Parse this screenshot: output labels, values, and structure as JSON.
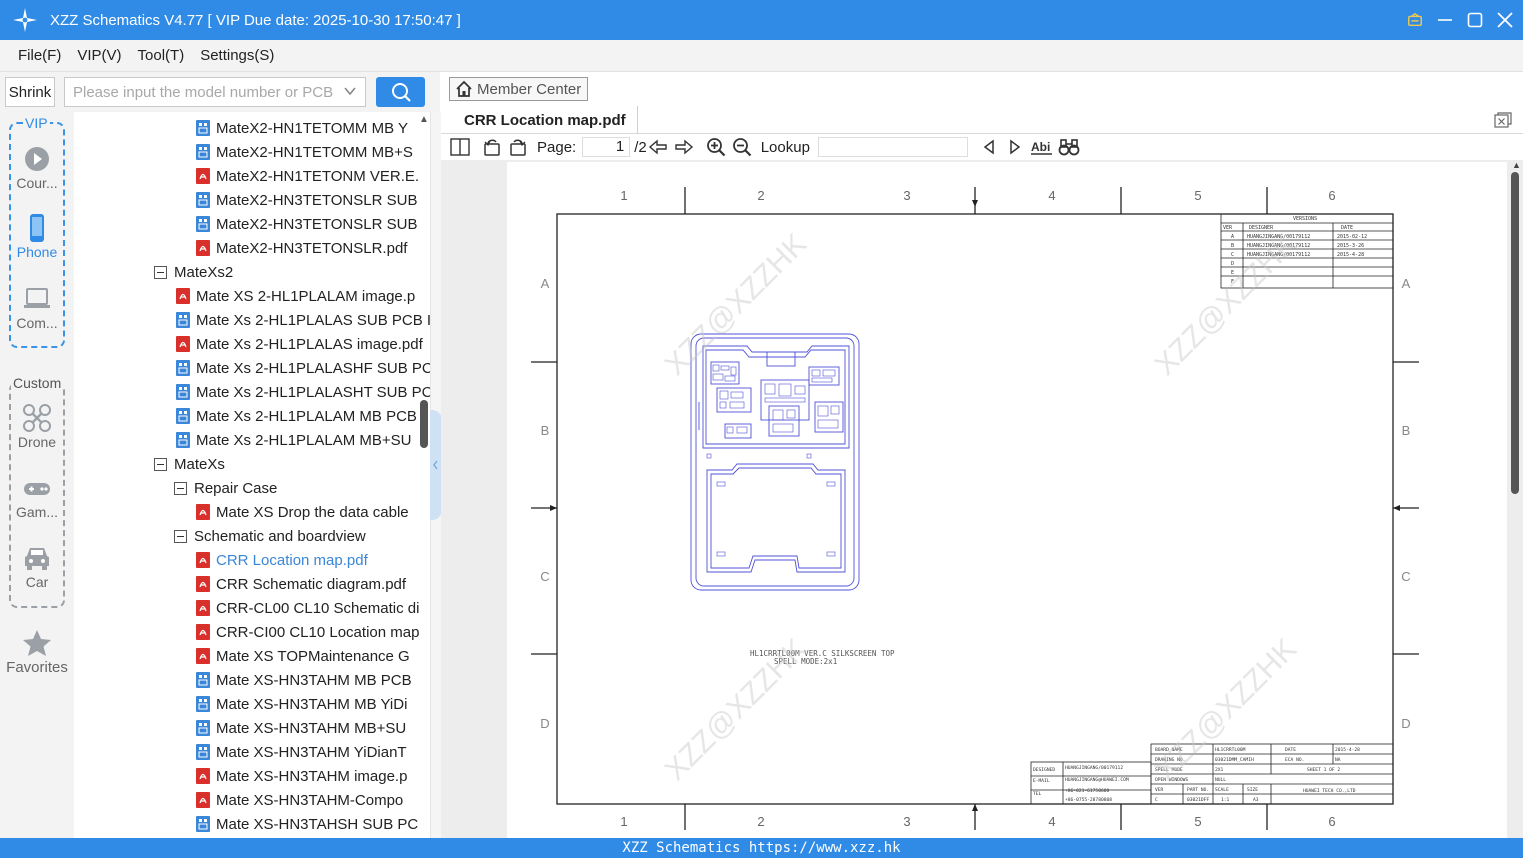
{
  "window": {
    "title": "XZZ Schematics V4.77 [ VIP Due date: 2025-10-30 17:50:47 ]",
    "controls": [
      "vip-crown-icon",
      "minimize-icon",
      "maximize-icon",
      "close-icon"
    ]
  },
  "menu": [
    "File(F)",
    "VIP(V)",
    "Tool(T)",
    "Settings(S)"
  ],
  "search": {
    "shrink_label": "Shrink",
    "placeholder": "Please input the model number or PCB"
  },
  "rail": {
    "vip_label": "VIP",
    "custom_label": "Custom",
    "vip_items": [
      {
        "label": "Cour...",
        "icon": "play-icon",
        "active": false
      },
      {
        "label": "Phone",
        "icon": "phone-icon",
        "active": true
      },
      {
        "label": "Com...",
        "icon": "laptop-icon",
        "active": false
      }
    ],
    "custom_items": [
      {
        "label": "Drone",
        "icon": "drone-icon"
      },
      {
        "label": "Gam...",
        "icon": "gamepad-icon"
      },
      {
        "label": "Car",
        "icon": "car-icon"
      }
    ],
    "favorites_label": "Favorites"
  },
  "tree": [
    {
      "type": "pcb",
      "label": "MateX2-HN1TETOMM MB Y",
      "indent": 2
    },
    {
      "type": "pcb",
      "label": "MateX2-HN1TETOMM MB+S",
      "indent": 2
    },
    {
      "type": "pdf",
      "label": "MateX2-HN1TETONM VER.E.",
      "indent": 2
    },
    {
      "type": "pcb",
      "label": "MateX2-HN3TETONSLR SUB",
      "indent": 2
    },
    {
      "type": "pcb",
      "label": "MateX2-HN3TETONSLR SUB",
      "indent": 2
    },
    {
      "type": "pdf",
      "label": "MateX2-HN3TETONSLR.pdf",
      "indent": 2
    },
    {
      "type": "folder",
      "label": "MateXs2",
      "indent": 0
    },
    {
      "type": "pdf",
      "label": "Mate XS 2-HL1PLALAM image.p",
      "indent": 1
    },
    {
      "type": "pcb",
      "label": "Mate Xs 2-HL1PLALAS SUB PCB I",
      "indent": 1
    },
    {
      "type": "pdf",
      "label": "Mate Xs 2-HL1PLALAS image.pdf",
      "indent": 1
    },
    {
      "type": "pcb",
      "label": "Mate Xs 2-HL1PLALASHF SUB PC",
      "indent": 1
    },
    {
      "type": "pcb",
      "label": "Mate Xs 2-HL1PLALASHT SUB PC",
      "indent": 1
    },
    {
      "type": "pcb",
      "label": "Mate Xs 2-HL1PLALAM MB PCB",
      "indent": 1
    },
    {
      "type": "pcb",
      "label": "Mate Xs 2-HL1PLALAM MB+SU",
      "indent": 1
    },
    {
      "type": "folder",
      "label": "MateXs",
      "indent": 0
    },
    {
      "type": "folder",
      "label": "Repair Case",
      "indent": 1
    },
    {
      "type": "pdf",
      "label": "Mate XS Drop the data cable",
      "indent": 2
    },
    {
      "type": "folder",
      "label": "Schematic and boardview",
      "indent": 1
    },
    {
      "type": "pdf",
      "label": "CRR Location map.pdf",
      "indent": 2,
      "selected": true
    },
    {
      "type": "pdf",
      "label": "CRR Schematic diagram.pdf",
      "indent": 2
    },
    {
      "type": "pdf",
      "label": "CRR-CL00 CL10 Schematic di",
      "indent": 2
    },
    {
      "type": "pdf",
      "label": "CRR-CI00 CL10 Location map",
      "indent": 2
    },
    {
      "type": "pdf",
      "label": "Mate XS TOPMaintenance G",
      "indent": 2
    },
    {
      "type": "pcb",
      "label": "Mate XS-HN3TAHM MB PCB",
      "indent": 2
    },
    {
      "type": "pcb",
      "label": "Mate XS-HN3TAHM MB YiDi",
      "indent": 2
    },
    {
      "type": "pcb",
      "label": "Mate XS-HN3TAHM MB+SU",
      "indent": 2
    },
    {
      "type": "pcb",
      "label": "Mate XS-HN3TAHM YiDianT",
      "indent": 2
    },
    {
      "type": "pdf",
      "label": "Mate XS-HN3TAHM image.p",
      "indent": 2
    },
    {
      "type": "pdf",
      "label": "Mate XS-HN3TAHM-Compo",
      "indent": 2
    },
    {
      "type": "pcb",
      "label": "Mate XS-HN3TAHSH SUB PC",
      "indent": 2
    }
  ],
  "viewer": {
    "member_center": "Member Center",
    "tab_title": "CRR Location map.pdf",
    "page_label": "Page:",
    "page_current": "1",
    "page_total": "/2",
    "lookup_label": "Lookup",
    "lookup_value": ""
  },
  "drawing": {
    "col_labels": [
      "1",
      "2",
      "3",
      "4",
      "5",
      "6"
    ],
    "row_labels": [
      "A",
      "B",
      "C",
      "D"
    ],
    "watermark": "XZZ@XZZHK",
    "silkscreen_line1": "HL1CRRTL00M VER.C SILKSCREEN TOP",
    "silkscreen_line2": "SPELL MODE:2x1",
    "versions_title": "VERSIONS",
    "versions_headers": [
      "VER",
      "DESIGNER",
      "DATE"
    ],
    "versions_rows": [
      [
        "A",
        "HUANGJINGANG/00179112",
        "2015-02-12"
      ],
      [
        "B",
        "HUANGJINGANG/00179112",
        "2015-3-26"
      ],
      [
        "C",
        "HUANGJINGANG/00179112",
        "2015-4-28"
      ],
      [
        "D",
        "",
        ""
      ],
      [
        "E",
        "",
        ""
      ],
      [
        "F",
        "",
        ""
      ]
    ],
    "titleblock": {
      "board_name_label": "BOARD NAME",
      "board_name": "HL1CRRTL00M",
      "date_label": "DATE",
      "date": "2015-4-28",
      "drawing_no_label": "DRAWING NO.",
      "drawing_no": "03021DMM_CAMIH",
      "eca_label": "ECA NO.",
      "eca": "NA",
      "spell_label": "SPELL MODE",
      "spell": "2X1",
      "sheet": "SHEET 1 OF 2",
      "open_label": "OPEN WINDOWS",
      "open": "NULL",
      "ver_label": "VER",
      "ver": "C",
      "part_label": "PART NO.",
      "part": "03021DFF",
      "scale_label": "SCALE",
      "scale": "1:1",
      "size_label": "SIZE",
      "size": "A3",
      "company": "HUAWEI TECH CO.,LTD",
      "designed_label": "DESIGNED",
      "designed": "HUANGJINGANG/00179112",
      "email_label": "E-MAIL",
      "email": "HUANGJINGANG@HUAWEI.COM",
      "tel_label": "TEL",
      "tel1": "+86-021-61750600",
      "tel2": "+86-0755-28780808"
    }
  },
  "status": "XZZ Schematics https://www.xzz.hk",
  "colors": {
    "accent": "#2f8be6",
    "pdf": "#d9302c",
    "pcb": "#3a86d8",
    "board": "#5050d8"
  }
}
